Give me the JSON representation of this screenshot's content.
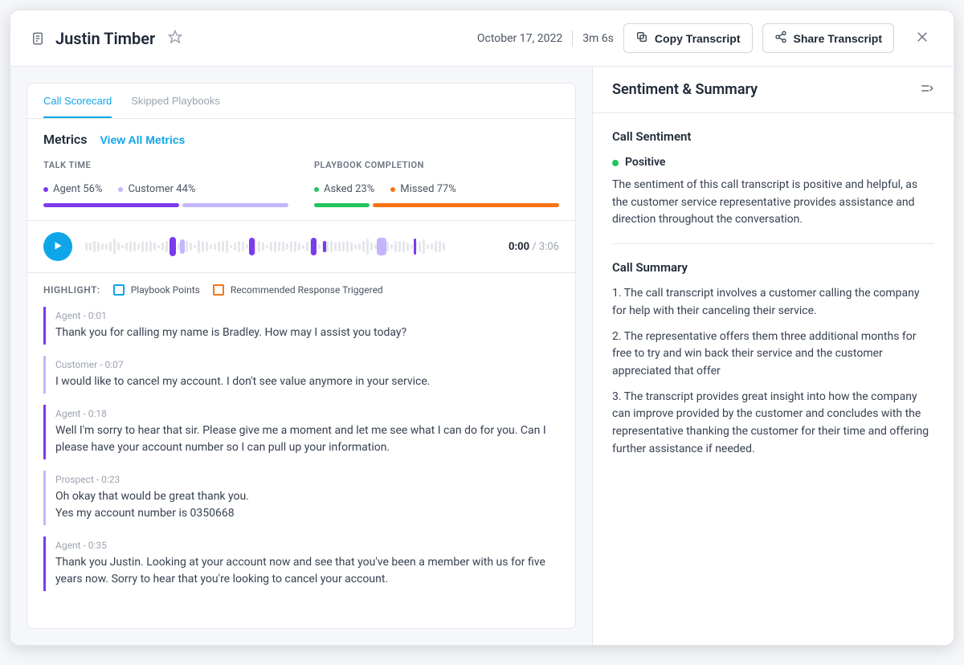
{
  "header": {
    "title": "Justin Timber",
    "date": "October 17, 2022",
    "duration": "3m 6s",
    "copy_label": "Copy Transcript",
    "share_label": "Share Transcript"
  },
  "tabs": {
    "scorecard": "Call Scorecard",
    "skipped": "Skipped Playbooks"
  },
  "metrics": {
    "heading": "Metrics",
    "view_all": "View All Metrics",
    "talk_time": {
      "label": "TALK TIME",
      "agent_label": "Agent 56%",
      "customer_label": "Customer 44%",
      "agent_pct": 56,
      "customer_pct": 44
    },
    "playbook": {
      "label": "PLAYBOOK COMPLETION",
      "asked_label": "Asked 23%",
      "missed_label": "Missed 77%",
      "asked_pct": 23,
      "missed_pct": 77
    }
  },
  "player": {
    "current": "0:00",
    "total": "3:06"
  },
  "highlight": {
    "label": "HIGHLIGHT:",
    "playbook": "Playbook Points",
    "response": "Recommended Response Triggered"
  },
  "transcript": [
    {
      "speaker": "Agent",
      "time": "0:01",
      "type": "agent",
      "text": "Thank you for calling my name is Bradley. How may I assist you today?"
    },
    {
      "speaker": "Customer",
      "time": "0:07",
      "type": "customer",
      "text": "I would like to cancel my account. I don't see value anymore in your service."
    },
    {
      "speaker": "Agent",
      "time": "0:18",
      "type": "agent",
      "text": "Well I'm sorry to hear that sir. Please give me a moment and let me see what I can do for you. Can I please have your account number so I can pull up your information."
    },
    {
      "speaker": "Prospect",
      "time": "0:23",
      "type": "customer",
      "text": "Oh okay that would be great thank you.\nYes my account number is 0350668"
    },
    {
      "speaker": "Agent ",
      "time": "0:35",
      "type": "agent",
      "text": "Thank you Justin. Looking at your account now and see that you've been a member with us for five years now. Sorry to hear that you're looking to cancel your account."
    }
  ],
  "sidebar": {
    "heading": "Sentiment & Summary",
    "sentiment_title": "Call Sentiment",
    "sentiment_value": "Positive",
    "sentiment_text": "The sentiment of this call transcript is positive and helpful, as the customer service representative provides assistance and direction throughout the conversation.",
    "summary_title": "Call Summary",
    "summary_items": [
      "1. The call transcript involves a customer calling the company for help with their canceling their service.",
      "2. The representative offers them three additional months for free to try and win back their service and the customer appreciated that offer",
      "3. The transcript provides great insight into how the company can improve provided by the customer and concludes with the representative thanking the customer for their time and offering further assistance if needed."
    ]
  },
  "colors": {
    "agent": "#7c3aed",
    "customer": "#c4b5fd",
    "asked": "#22c55e",
    "missed": "#f97316",
    "positive": "#22c55e"
  }
}
